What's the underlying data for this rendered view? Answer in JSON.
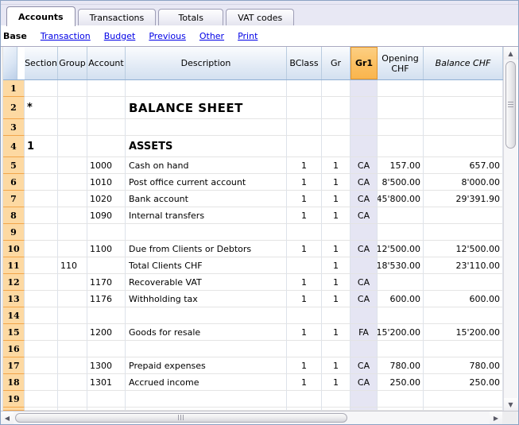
{
  "tabs": [
    {
      "label": "Accounts",
      "active": true
    },
    {
      "label": "Transactions",
      "active": false
    },
    {
      "label": "Totals",
      "active": false
    },
    {
      "label": "VAT codes",
      "active": false
    }
  ],
  "menubar": {
    "base": "Base",
    "links": [
      "Transaction",
      "Budget",
      "Previous",
      "Other",
      "Print"
    ]
  },
  "table": {
    "selected_column": "Gr1",
    "headers": [
      "",
      "Section",
      "Group",
      "Account",
      "Description",
      "BClass",
      "Gr",
      "Gr1",
      "Opening CHF",
      "Balance CHF"
    ],
    "rows": [
      {
        "n": "1"
      },
      {
        "n": "2",
        "section": "*",
        "desc": "BALANCE SHEET",
        "style": "title"
      },
      {
        "n": "3"
      },
      {
        "n": "4",
        "section": "1",
        "desc": "ASSETS",
        "style": "heading"
      },
      {
        "n": "5",
        "account": "1000",
        "desc": "Cash on hand",
        "bclass": "1",
        "gr": "1",
        "gr1": "CA",
        "opening": "157.00",
        "balance": "657.00"
      },
      {
        "n": "6",
        "account": "1010",
        "desc": "Post office current account",
        "bclass": "1",
        "gr": "1",
        "gr1": "CA",
        "opening": "8'500.00",
        "balance": "8'000.00"
      },
      {
        "n": "7",
        "account": "1020",
        "desc": "Bank account",
        "bclass": "1",
        "gr": "1",
        "gr1": "CA",
        "opening": "45'800.00",
        "balance": "29'391.90"
      },
      {
        "n": "8",
        "account": "1090",
        "desc": "Internal transfers",
        "bclass": "1",
        "gr": "1",
        "gr1": "CA"
      },
      {
        "n": "9"
      },
      {
        "n": "10",
        "account": "1100",
        "desc": "Due from Clients or Debtors",
        "bclass": "1",
        "gr": "1",
        "gr1": "CA",
        "opening": "12'500.00",
        "balance": "12'500.00"
      },
      {
        "n": "11",
        "group": "110",
        "desc": "Total Clients CHF",
        "gr": "1",
        "opening": "18'530.00",
        "balance": "23'110.00"
      },
      {
        "n": "12",
        "account": "1170",
        "desc": "Recoverable VAT",
        "bclass": "1",
        "gr": "1",
        "gr1": "CA"
      },
      {
        "n": "13",
        "account": "1176",
        "desc": "Withholding tax",
        "bclass": "1",
        "gr": "1",
        "gr1": "CA",
        "opening": "600.00",
        "balance": "600.00"
      },
      {
        "n": "14"
      },
      {
        "n": "15",
        "account": "1200",
        "desc": "Goods for resale",
        "bclass": "1",
        "gr": "1",
        "gr1": "FA",
        "opening": "15'200.00",
        "balance": "15'200.00"
      },
      {
        "n": "16"
      },
      {
        "n": "17",
        "account": "1300",
        "desc": "Prepaid expenses",
        "bclass": "1",
        "gr": "1",
        "gr1": "CA",
        "opening": "780.00",
        "balance": "780.00"
      },
      {
        "n": "18",
        "account": "1301",
        "desc": "Accrued income",
        "bclass": "1",
        "gr": "1",
        "gr1": "CA",
        "opening": "250.00",
        "balance": "250.00"
      },
      {
        "n": "19"
      }
    ]
  },
  "colors": {
    "row_header_bg": "#FDD9A2",
    "row_header_border": "#F2A64B",
    "selected_column_header_bg": "#FBBE5E",
    "selected_column_bg": "#E5E5F3",
    "header_gradient_top": "#FBFCFE",
    "header_gradient_bottom": "#D3E0F0",
    "link_blue": "#0000E6",
    "frame_blue": "#8BA2C4"
  }
}
